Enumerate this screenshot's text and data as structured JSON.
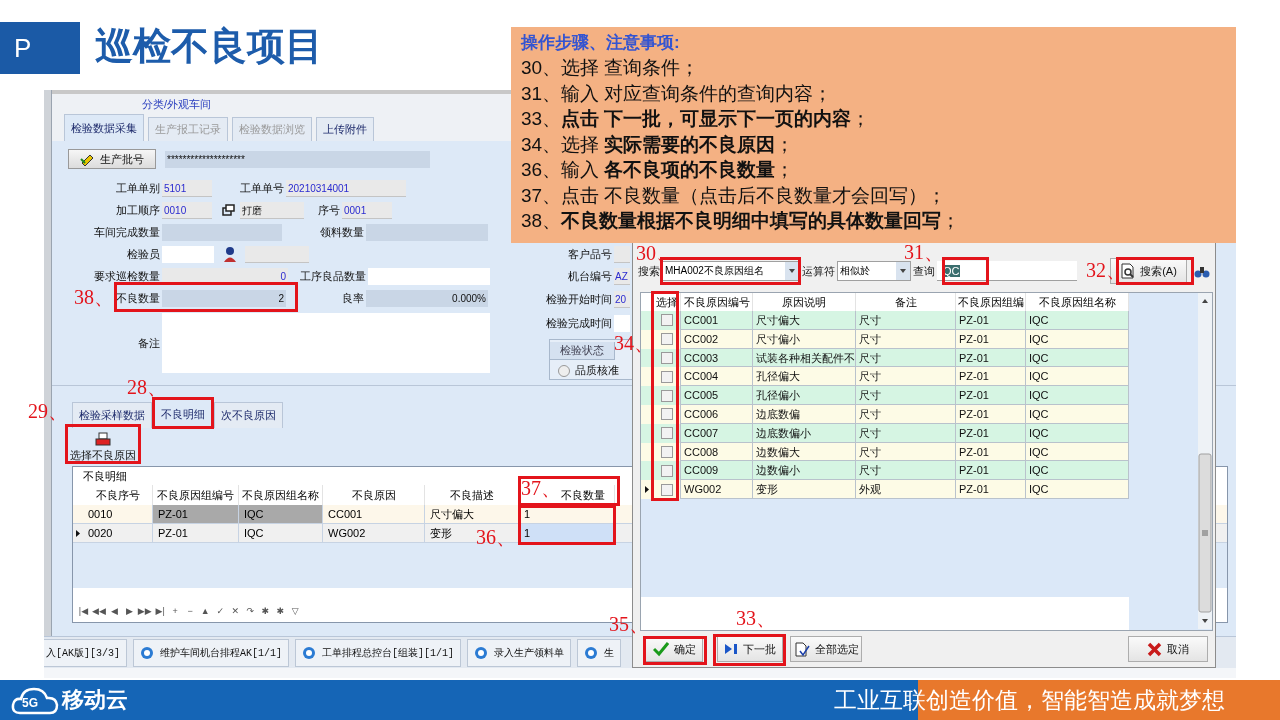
{
  "slide": {
    "badge": "P",
    "title": "巡检不良项目"
  },
  "note": {
    "heading": "操作步骤、注意事项:",
    "lines": [
      "30、选择 查询条件；",
      "31、输入 对应查询条件的查询内容；",
      "33、**点击 下一批，可显示下一页的内容**；",
      "34、选择 **实际需要的不良原因**；",
      "36、输入 **各不良项的不良数量**；",
      "37、点击 不良数量（点击后不良数量才会回写）；",
      "38、**不良数量根据不良明细中填写的具体数量回写**；"
    ]
  },
  "main_window": {
    "caption": "分类/外观车间",
    "tabs": [
      {
        "label": "检验数据采集",
        "selected": true,
        "disabled": false
      },
      {
        "label": "生产报工记录",
        "selected": false,
        "disabled": true
      },
      {
        "label": "检验数据浏览",
        "selected": false,
        "disabled": true
      },
      {
        "label": "上传附件",
        "selected": false,
        "disabled": false
      }
    ],
    "batch_button": "生产批号",
    "batch_value": "********************",
    "form_rows": [
      [
        {
          "label": "工单单别",
          "value": "5101",
          "kind": "text"
        },
        {
          "label": "工单单号",
          "value": "20210314001",
          "kind": "text"
        }
      ],
      [
        {
          "label": "加工顺序",
          "value": "0010",
          "kind": "text"
        },
        {
          "value": "打磨",
          "kind": "lookup"
        },
        {
          "label": "序号",
          "value": "0001",
          "kind": "text"
        }
      ],
      [
        {
          "label": "车间完成数量",
          "kind": "text"
        },
        {
          "label": "领料数量",
          "kind": "text"
        }
      ],
      [
        {
          "label": "检验员",
          "kind": "text"
        },
        {
          "kind": "picker"
        }
      ],
      [
        {
          "label": "要求巡检数量",
          "value": "0",
          "kind": "text"
        },
        {
          "label": "工序良品数量",
          "kind": "text"
        }
      ],
      [
        {
          "label": "不良数量",
          "value": "2",
          "kind": "text"
        },
        {
          "label": "良率",
          "value": "0.000%",
          "kind": "text"
        }
      ]
    ],
    "remarks_label": "备注",
    "right_fields": [
      {
        "label": "客户品号"
      },
      {
        "label": "机台编号",
        "value": "AZ"
      },
      {
        "label": "检验开始时间",
        "value": "20"
      },
      {
        "label": "检验完成时间"
      }
    ],
    "status_group": {
      "title": "检验状态",
      "options": [
        {
          "label": "品质核准",
          "selected": false
        }
      ]
    },
    "sub_tabs": [
      {
        "label": "检验采样数据",
        "selected": false
      },
      {
        "label": "不良明细",
        "selected": true
      },
      {
        "label": "次不良原因",
        "selected": false
      }
    ],
    "select_button": "选择不良原因",
    "detail_grid": {
      "caption": "不良明细",
      "columns": [
        "不良序号",
        "不良原因组编号",
        "不良原因组名称",
        "不良原因",
        "不良描述",
        "不良数量"
      ],
      "rows": [
        {
          "current": false,
          "cells": [
            {
              "text": "0010",
              "kind": "plain"
            },
            {
              "text": "PZ-01",
              "kind": "shaded"
            },
            {
              "text": "IQC",
              "kind": "shaded"
            },
            {
              "text": "CC001",
              "kind": "plain"
            },
            {
              "text": "尺寸偏大",
              "kind": "plain"
            },
            {
              "text": "1",
              "kind": "plain"
            }
          ]
        },
        {
          "current": true,
          "cells": [
            {
              "text": "0020",
              "kind": "plain"
            },
            {
              "text": "PZ-01",
              "kind": "plain"
            },
            {
              "text": "IQC",
              "kind": "plain"
            },
            {
              "text": "WG002",
              "kind": "plain"
            },
            {
              "text": "变形",
              "kind": "plain"
            },
            {
              "text": "1",
              "kind": "focused"
            }
          ]
        }
      ]
    },
    "navigator": [
      "|◀",
      "◀◀",
      "◀",
      "▶",
      "▶▶",
      "▶|",
      "+",
      "−",
      "▲",
      "✓",
      "✕",
      "↷",
      "✱",
      "✱",
      "▽"
    ]
  },
  "taskbar": [
    {
      "label": "入[AK版][3/3]",
      "icon": false
    },
    {
      "label": "维护车间机台排程AK[1/1]",
      "icon": true
    },
    {
      "label": "工单排程总控台[组装][1/1]",
      "icon": true
    },
    {
      "label": "录入生产领料单",
      "icon": true
    },
    {
      "label": "生",
      "icon": true
    }
  ],
  "dialog": {
    "search_label": "搜索",
    "search_field": "MHA002不良原因组名",
    "operator_label": "运算符",
    "operator": "相似於",
    "query_label": "查询",
    "query": "QC",
    "search_button": "搜索(A)",
    "select_column": "选择",
    "columns": [
      "不良原因编号",
      "原因说明",
      "备注",
      "不良原因组编",
      "不良原因组名称"
    ],
    "rows": [
      {
        "checked": false,
        "current": false,
        "cells": [
          "CC001",
          "尺寸偏大",
          "尺寸",
          "PZ-01",
          "IQC"
        ]
      },
      {
        "checked": false,
        "current": false,
        "cells": [
          "CC002",
          "尺寸偏小",
          "尺寸",
          "PZ-01",
          "IQC"
        ]
      },
      {
        "checked": false,
        "current": false,
        "cells": [
          "CC003",
          "试装各种相关配件不",
          "尺寸",
          "PZ-01",
          "IQC"
        ]
      },
      {
        "checked": false,
        "current": false,
        "cells": [
          "CC004",
          "孔径偏大",
          "尺寸",
          "PZ-01",
          "IQC"
        ]
      },
      {
        "checked": false,
        "current": false,
        "cells": [
          "CC005",
          "孔径偏小",
          "尺寸",
          "PZ-01",
          "IQC"
        ]
      },
      {
        "checked": false,
        "current": false,
        "cells": [
          "CC006",
          "边底数偏",
          "尺寸",
          "PZ-01",
          "IQC"
        ]
      },
      {
        "checked": false,
        "current": false,
        "cells": [
          "CC007",
          "边底数偏小",
          "尺寸",
          "PZ-01",
          "IQC"
        ]
      },
      {
        "checked": false,
        "current": false,
        "cells": [
          "CC008",
          "边数偏大",
          "尺寸",
          "PZ-01",
          "IQC"
        ]
      },
      {
        "checked": false,
        "current": false,
        "cells": [
          "CC009",
          "边数偏小",
          "尺寸",
          "PZ-01",
          "IQC"
        ]
      },
      {
        "checked": false,
        "current": true,
        "cells": [
          "WG002",
          "变形",
          "外观",
          "PZ-01",
          "IQC"
        ]
      }
    ],
    "buttons": [
      {
        "label": "确定",
        "kind": "confirm"
      },
      {
        "label": "下一批",
        "kind": "next"
      },
      {
        "label": "全部选定",
        "kind": "select-all"
      },
      {
        "label": "取消",
        "kind": "cancel"
      }
    ]
  },
  "callouts": [
    "38、",
    "28、",
    "29、",
    "37、",
    "36、",
    "30、",
    "31、",
    "32、",
    "34、",
    "35、",
    "33、"
  ],
  "footer": {
    "logo_badge": "5G",
    "logo_text": "移动云",
    "slogan": "工业互联创造价值，智能智造成就梦想"
  }
}
